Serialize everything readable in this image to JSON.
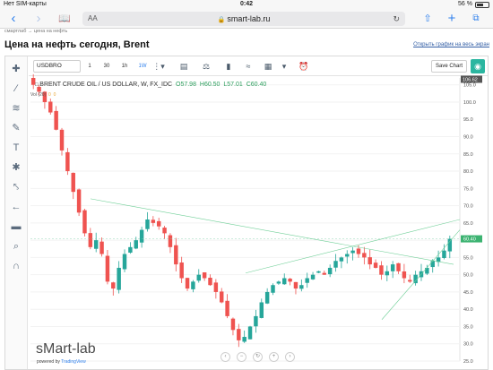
{
  "status": {
    "carrier": "Нет SIM-карты",
    "time": "0:42",
    "battery": "56 %"
  },
  "browser": {
    "url": "smart-lab.ru",
    "aa": "AA",
    "back_icon": "chevron-left-icon",
    "forward_icon": "chevron-right-icon",
    "bookmarks_icon": "book-icon",
    "share_icon": "share-icon",
    "add_icon": "plus-icon",
    "tabs_icon": "tabs-icon"
  },
  "breadcrumb": "смартлаб → цена на нефть",
  "page": {
    "title": "Цена на нефть сегодня, Brent",
    "full_screen_link": "Открыть график на весь экран"
  },
  "toolbar": {
    "symbol": "USDBRO",
    "timeframes": [
      "1",
      "30",
      "1h",
      "1W"
    ],
    "active_timeframe": "1W",
    "save_label": "Save Chart"
  },
  "legend": {
    "title": "BRENT CRUDE OIL / US DOLLAR, W, FX_IDC",
    "o_label": "O",
    "o": "57.98",
    "h_label": "H",
    "h": "60.50",
    "l_label": "L",
    "l": "57.01",
    "c_label": "C",
    "c": "60.40",
    "volume_label": "Vol (20)",
    "volume_value_1": "0",
    "volume_value_2": "0"
  },
  "watermark": "sMart-lab",
  "powered_by": "powered by",
  "powered_brand": "TradingView",
  "colors": {
    "up": "#26a69a",
    "down": "#ef5350",
    "trendline": "#6fcf97",
    "accent": "#2f80ed"
  },
  "chart_data": {
    "type": "candlestick",
    "title": "BRENT CRUDE OIL / US DOLLAR, W, FX_IDC",
    "ylim": [
      25,
      107
    ],
    "y_ticks": [
      105,
      100,
      95,
      90,
      85,
      80,
      75,
      70,
      65,
      60,
      55,
      50,
      45,
      40,
      35,
      30,
      25
    ],
    "last_price": 60.4,
    "max_label": 106.62,
    "ohlc_close_series": [
      105,
      103,
      100,
      97,
      92,
      86,
      80,
      74,
      68,
      62,
      58,
      60,
      56,
      48,
      46,
      52,
      56,
      58,
      60,
      63,
      66,
      65,
      64,
      62,
      58,
      53,
      49,
      46,
      48,
      50,
      49,
      47,
      45,
      42,
      38,
      34,
      31,
      32,
      35,
      38,
      42,
      45,
      47,
      48,
      49,
      48,
      46,
      47,
      49,
      50,
      51,
      50,
      52,
      54,
      55,
      56,
      57,
      56,
      55,
      53,
      52,
      50,
      51,
      53,
      51,
      49,
      48,
      50,
      51,
      52,
      54,
      55,
      57,
      60.4
    ]
  }
}
